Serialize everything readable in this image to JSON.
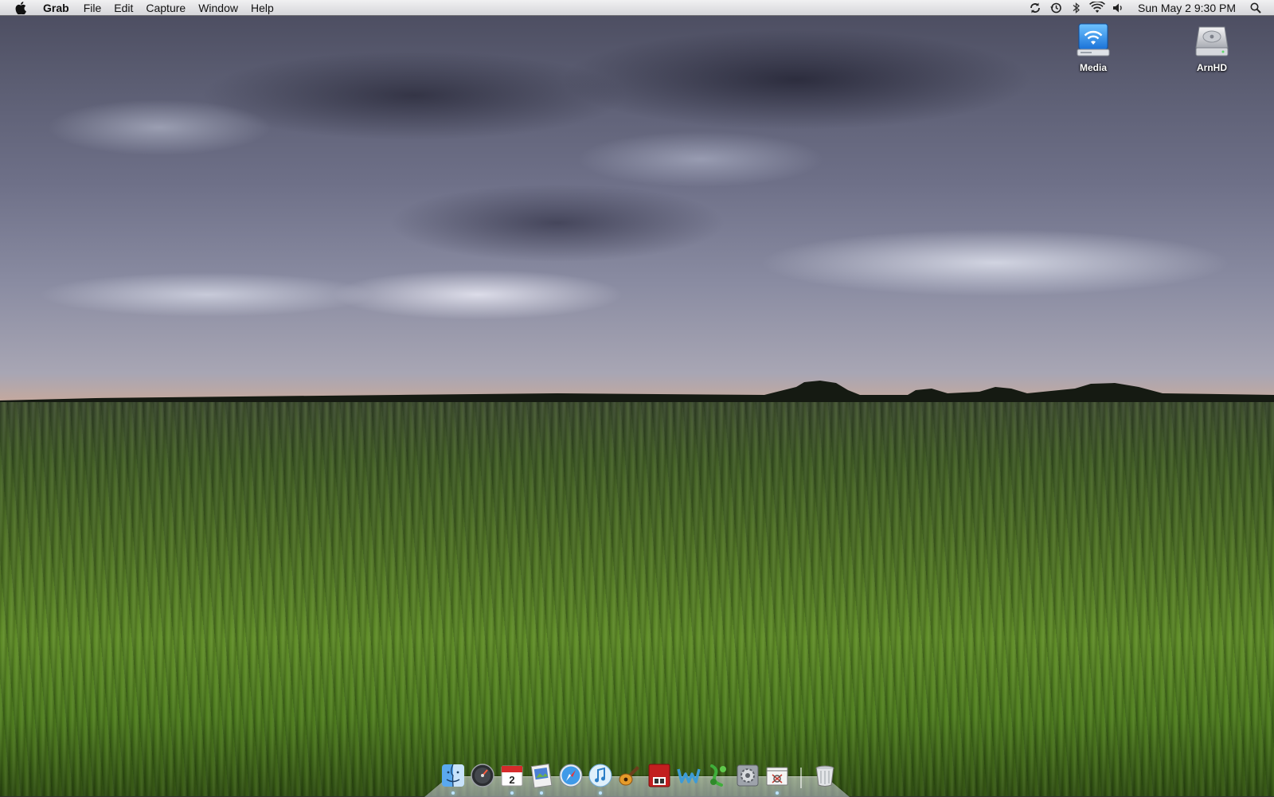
{
  "menubar": {
    "apple_icon": "apple-icon",
    "app_name": "Grab",
    "menus": [
      "File",
      "Edit",
      "Capture",
      "Window",
      "Help"
    ],
    "status_icons": [
      "sync-icon",
      "time-machine-icon",
      "bluetooth-icon",
      "wifi-icon",
      "volume-icon"
    ],
    "clock": "Sun May 2  9:30 PM",
    "spotlight_icon": "spotlight-search-icon"
  },
  "desktop": {
    "icons": [
      {
        "label": "Media",
        "icon": "network-drive-icon"
      },
      {
        "label": "ArnHD",
        "icon": "hard-disk-icon"
      }
    ]
  },
  "dock": {
    "items": [
      {
        "icon": "finder-icon"
      },
      {
        "icon": "dashboard-icon"
      },
      {
        "icon": "ical-icon",
        "badge": "2"
      },
      {
        "icon": "preview-icon"
      },
      {
        "icon": "safari-icon"
      },
      {
        "icon": "itunes-icon"
      },
      {
        "icon": "garageband-icon"
      },
      {
        "icon": "photo-booth-icon"
      },
      {
        "icon": "textwrangler-icon"
      },
      {
        "icon": "automator-icon"
      },
      {
        "icon": "system-preferences-icon"
      },
      {
        "icon": "grab-icon"
      },
      {
        "icon": "trash-icon"
      }
    ]
  },
  "colors": {
    "menubar_bg": "#ececee",
    "sky": "#5b5d72",
    "field": "#4c6e25"
  }
}
